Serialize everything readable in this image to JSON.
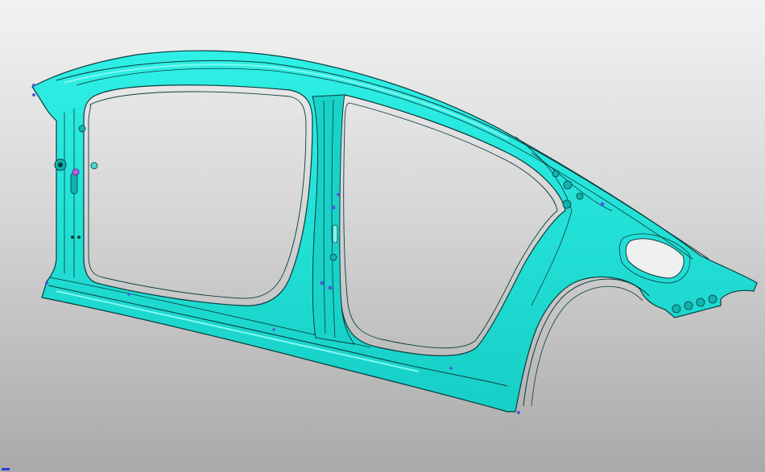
{
  "viewer": {
    "background_top": "#f2f2f2",
    "background_bottom": "#a9a9a9"
  },
  "model": {
    "part": "body-side-outer-panel",
    "fill_color": "#1ee0d6",
    "shade_color": "#10b3ad",
    "edge_color": "#0a3c3c",
    "highlight_color": "#7ff7f0",
    "feature_point_color": "#4a5bd8",
    "pin_color": "#b060e0"
  },
  "axis_indicator": {
    "color": "#2f3fd0"
  }
}
